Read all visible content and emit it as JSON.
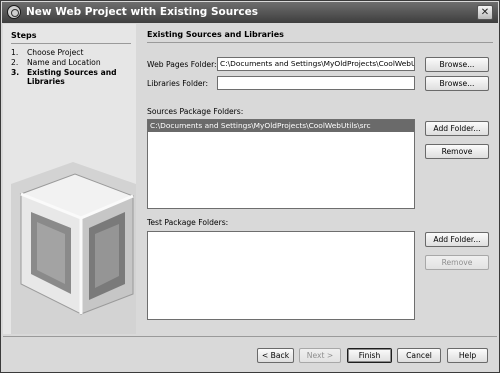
{
  "window": {
    "title": "New Web Project with Existing Sources",
    "close_glyph": "✕"
  },
  "steps": {
    "title": "Steps",
    "items": [
      {
        "num": "1.",
        "label": "Choose Project",
        "current": false
      },
      {
        "num": "2.",
        "label": "Name and Location",
        "current": false
      },
      {
        "num": "3.",
        "label": "Existing Sources and",
        "label_line2": "Libraries",
        "current": true
      }
    ]
  },
  "main": {
    "section_title": "Existing Sources and Libraries",
    "web_pages_folder": {
      "label": "Web Pages Folder:",
      "value": "C:\\Documents and Settings\\MyOldProjects\\CoolWebUtils\\web",
      "browse_label": "Browse..."
    },
    "libraries_folder": {
      "label": "Libraries Folder:",
      "value": "",
      "browse_label": "Browse..."
    },
    "sources_package_folders": {
      "label": "Sources Package Folders:",
      "items": [
        "C:\\Documents and Settings\\MyOldProjects\\CoolWebUtils\\src"
      ],
      "add_label": "Add Folder...",
      "remove_label": "Remove",
      "remove_enabled": true
    },
    "test_package_folders": {
      "label": "Test Package Folders:",
      "items": [],
      "add_label": "Add Folder...",
      "remove_label": "Remove",
      "remove_enabled": false
    }
  },
  "footer": {
    "back_label": "< Back",
    "next_label": "Next >",
    "finish_label": "Finish",
    "cancel_label": "Cancel",
    "help_label": "Help"
  }
}
